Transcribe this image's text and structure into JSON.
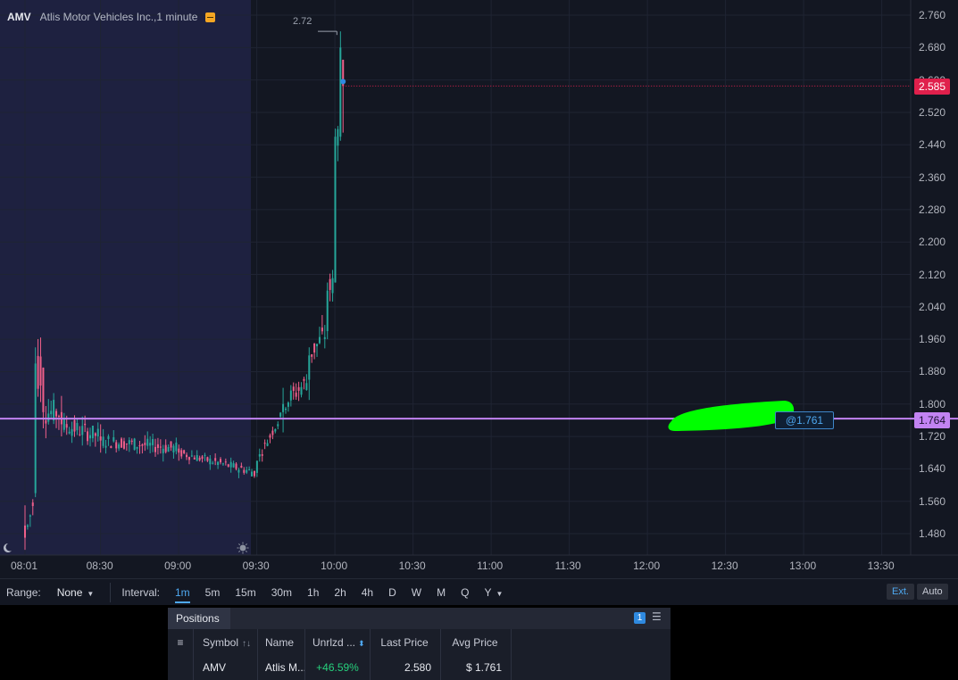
{
  "legend": {
    "symbol": "AMV",
    "description": "Atlis Motor Vehicles Inc.,1 minute",
    "flag_icon": "flag-icon"
  },
  "price_axis": {
    "labels": [
      "2.760",
      "2.680",
      "2.600",
      "2.520",
      "2.440",
      "2.360",
      "2.280",
      "2.200",
      "2.120",
      "2.040",
      "1.960",
      "1.880",
      "1.800",
      "1.720",
      "1.640",
      "1.560",
      "1.480"
    ],
    "last_price_badge": "2.585",
    "position_price_badge": "1.764"
  },
  "time_axis": {
    "labels": [
      "08:01",
      "08:30",
      "09:00",
      "09:30",
      "10:00",
      "10:30",
      "11:00",
      "11:30",
      "12:00",
      "12:30",
      "13:00",
      "13:30"
    ]
  },
  "chart": {
    "peak_label": "2.72",
    "position_tag": "@1.761",
    "premarket_icon": "moon-icon",
    "market_open_icon": "sun-icon",
    "colors": {
      "background": "#131722",
      "premarket_shade": "#1e2140",
      "up": "#26a69a",
      "down": "#ef5f8a",
      "position_line": "#c283f2",
      "last_price_line": "#e0204c",
      "redaction": "#00ff00"
    }
  },
  "toolbar": {
    "range_label": "Range:",
    "range_value": "None",
    "interval_label": "Interval:",
    "intervals": [
      "1m",
      "5m",
      "15m",
      "30m",
      "1h",
      "2h",
      "4h",
      "D",
      "W",
      "M",
      "Q",
      "Y"
    ],
    "active_interval": "1m",
    "ext_button": "Ext.",
    "auto_button": "Auto"
  },
  "positions": {
    "tab_label": "Positions",
    "count": "1",
    "columns": {
      "symbol": "Symbol",
      "name": "Name",
      "unrealized": "Unrlzd ...",
      "last_price": "Last Price",
      "avg_price": "Avg Price"
    },
    "rows": [
      {
        "symbol": "AMV",
        "name": "Atlis M...",
        "unrealized": "+46.59%",
        "last_price": "2.580",
        "avg_price": "$ 1.761"
      }
    ]
  },
  "chart_data": {
    "type": "candlestick",
    "symbol": "AMV",
    "interval": "1 minute",
    "ylim": [
      1.44,
      2.78
    ],
    "x_ticks": [
      "08:01",
      "08:30",
      "09:00",
      "09:30",
      "10:00",
      "10:30",
      "11:00",
      "11:30",
      "12:00",
      "12:30",
      "13:00",
      "13:30"
    ],
    "last_price": 2.585,
    "position_price": 1.764,
    "avg_price": 1.761,
    "high_marker": 2.72,
    "candles_sampled": [
      {
        "t": "08:01",
        "o": 1.5,
        "h": 1.55,
        "l": 1.44,
        "c": 1.47
      },
      {
        "t": "08:05",
        "o": 1.58,
        "h": 1.94,
        "l": 1.57,
        "c": 1.9
      },
      {
        "t": "08:08",
        "o": 1.89,
        "h": 1.89,
        "l": 1.74,
        "c": 1.78
      },
      {
        "t": "08:15",
        "o": 1.78,
        "h": 1.82,
        "l": 1.72,
        "c": 1.75
      },
      {
        "t": "08:30",
        "o": 1.72,
        "h": 1.75,
        "l": 1.68,
        "c": 1.71
      },
      {
        "t": "09:00",
        "o": 1.69,
        "h": 1.7,
        "l": 1.66,
        "c": 1.68
      },
      {
        "t": "09:30",
        "o": 1.63,
        "h": 1.66,
        "l": 1.62,
        "c": 1.66
      },
      {
        "t": "09:40",
        "o": 1.78,
        "h": 1.84,
        "l": 1.73,
        "c": 1.8
      },
      {
        "t": "09:50",
        "o": 1.86,
        "h": 1.94,
        "l": 1.81,
        "c": 1.92
      },
      {
        "t": "09:57",
        "o": 1.98,
        "h": 2.1,
        "l": 1.96,
        "c": 2.08
      },
      {
        "t": "10:00",
        "o": 2.1,
        "h": 2.48,
        "l": 2.1,
        "c": 2.46
      },
      {
        "t": "10:02",
        "o": 2.46,
        "h": 2.72,
        "l": 2.45,
        "c": 2.68
      },
      {
        "t": "10:03",
        "o": 2.65,
        "h": 2.65,
        "l": 2.47,
        "c": 2.585
      }
    ]
  }
}
